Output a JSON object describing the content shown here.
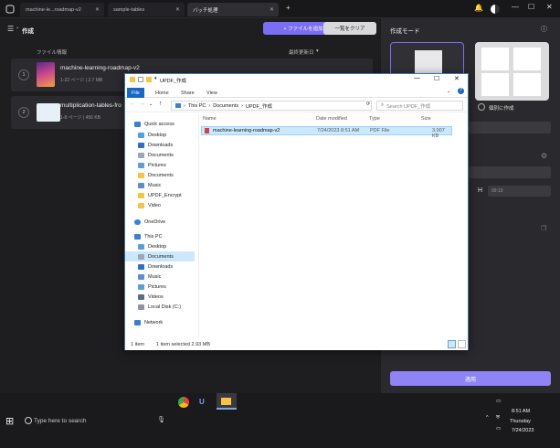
{
  "tabs": [
    {
      "label": "machine-le...roadmap-v2"
    },
    {
      "label": "sample-tables"
    },
    {
      "label": "バッチ処理"
    }
  ],
  "toolbar": {
    "title": "作成",
    "add_files": "+ ファイルを追加",
    "clear_all": "一覧をクリア"
  },
  "columns": {
    "file_info": "ファイル情報",
    "last_updated": "最終更新日"
  },
  "files": [
    {
      "num": "1",
      "name": "machine-learning-roadmap-v2",
      "meta": "1-22 ページ   |   2.7 MB"
    },
    {
      "num": "2",
      "name": "multiplication-tables-fro",
      "meta": "1-8 ページ   |   456 KB"
    }
  ],
  "side": {
    "title": "作成モード",
    "separate_label": "個別に作成",
    "time_value": "09:10",
    "apply": "適用"
  },
  "explorer": {
    "title": "UPDF_作成",
    "ribbon": [
      "File",
      "Home",
      "Share",
      "View"
    ],
    "address": [
      "This PC",
      "Documents",
      "UPDF_作成"
    ],
    "search_placeholder": "Search UPDF_作成",
    "nav": {
      "quick_access": "Quick access",
      "qa_items": [
        "Desktop",
        "Downloads",
        "Documents",
        "Pictures",
        "Documents",
        "Music",
        "UPDF_Encrypt",
        "Video"
      ],
      "onedrive": "OneDrive",
      "this_pc": "This PC",
      "pc_items": [
        "Desktop",
        "Documents",
        "Downloads",
        "Music",
        "Pictures",
        "Videos",
        "Local Disk (C:)"
      ],
      "network": "Network"
    },
    "headers": {
      "name": "Name",
      "date": "Date modified",
      "type": "Type",
      "size": "Size"
    },
    "file": {
      "name": "machine-learning-roadmap-v2",
      "date": "7/24/2023 8:51 AM",
      "type": "PDF File",
      "size": "3,007 KB"
    },
    "status": {
      "count": "1 item",
      "selected": "1 item selected  2.93 MB"
    }
  },
  "taskbar": {
    "search_placeholder": "Type here to search",
    "time": "8:51 AM",
    "day": "Thursday",
    "date": "7/24/2023"
  }
}
